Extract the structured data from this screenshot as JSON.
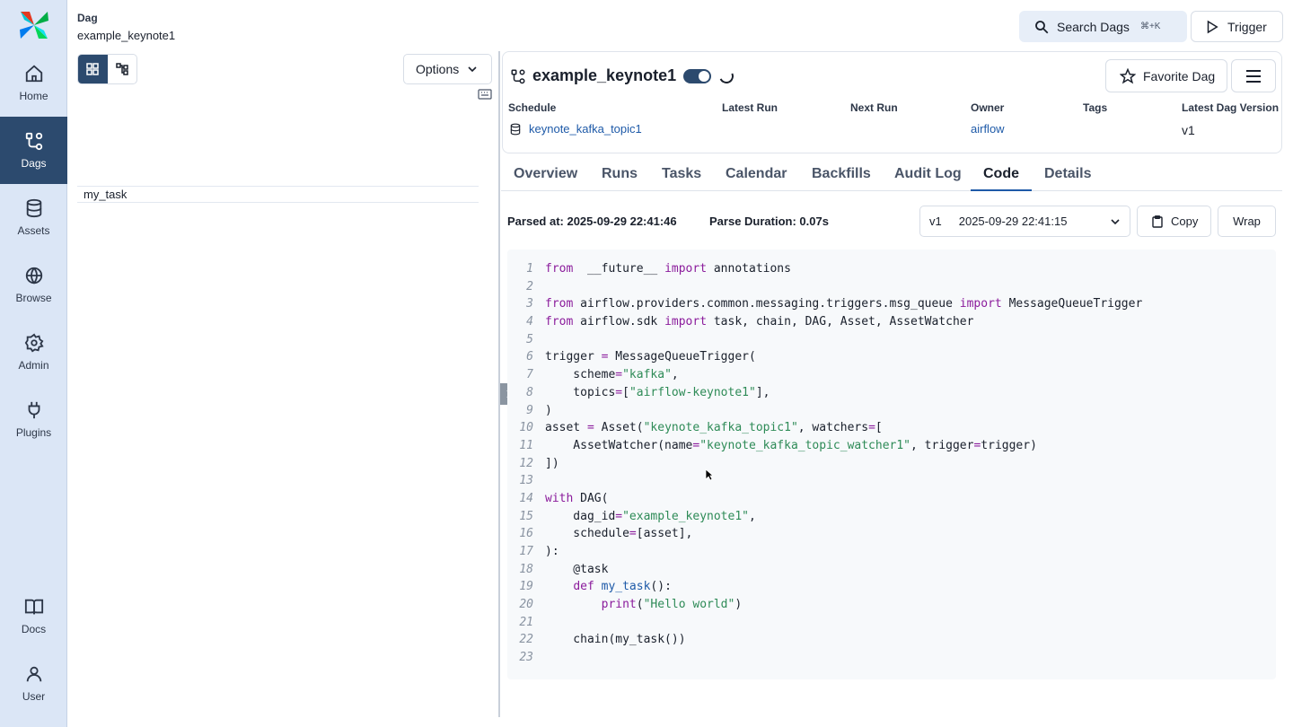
{
  "colors": {
    "sidebar_bg": "#dbe6f6",
    "active_nav": "#2c4a6e",
    "link": "#1e5aa8",
    "keyword": "#8b1c9c",
    "string": "#2e8b57"
  },
  "sidebar": {
    "items": [
      {
        "label": "Home",
        "icon": "home-icon"
      },
      {
        "label": "Dags",
        "icon": "dags-icon"
      },
      {
        "label": "Assets",
        "icon": "database-icon"
      },
      {
        "label": "Browse",
        "icon": "globe-icon"
      },
      {
        "label": "Admin",
        "icon": "gear-icon"
      },
      {
        "label": "Plugins",
        "icon": "plug-icon"
      },
      {
        "label": "Docs",
        "icon": "book-icon"
      },
      {
        "label": "User",
        "icon": "user-icon"
      }
    ]
  },
  "header": {
    "crumb_label": "Dag",
    "crumb_value": "example_keynote1",
    "search_label": "Search Dags",
    "search_shortcut": "⌘+K",
    "trigger_label": "Trigger"
  },
  "left_panel": {
    "options_label": "Options",
    "task_name": "my_task"
  },
  "dag": {
    "name": "example_keynote1",
    "favorite_label": "Favorite Dag",
    "meta_headers": {
      "schedule": "Schedule",
      "latest_run": "Latest Run",
      "next_run": "Next Run",
      "owner": "Owner",
      "tags": "Tags",
      "latest_version": "Latest Dag Version"
    },
    "schedule_value": "keynote_kafka_topic1",
    "owner_value": "airflow",
    "version_value": "v1"
  },
  "tabs": [
    "Overview",
    "Runs",
    "Tasks",
    "Calendar",
    "Backfills",
    "Audit Log",
    "Code",
    "Details"
  ],
  "code_view": {
    "parsed_at": "Parsed at: 2025-09-29 22:41:46",
    "parse_duration": "Parse Duration: 0.07s",
    "version": "v1",
    "version_date": "2025-09-29 22:41:15",
    "copy_label": "Copy",
    "wrap_label": "Wrap"
  },
  "code_lines": [
    [
      [
        "kw",
        "from"
      ],
      [
        "",
        "  __future__ "
      ],
      [
        "kw",
        "import"
      ],
      [
        "",
        " annotations"
      ]
    ],
    [],
    [
      [
        "kw",
        "from"
      ],
      [
        "",
        " airflow.providers.common.messaging.triggers.msg_queue "
      ],
      [
        "kw",
        "import"
      ],
      [
        "",
        " MessageQueueTrigger"
      ]
    ],
    [
      [
        "kw",
        "from"
      ],
      [
        "",
        " airflow.sdk "
      ],
      [
        "kw",
        "import"
      ],
      [
        "",
        " task, chain, DAG, Asset, AssetWatcher"
      ]
    ],
    [],
    [
      [
        "",
        "trigger "
      ],
      [
        "op",
        "="
      ],
      [
        "",
        " MessageQueueTrigger("
      ]
    ],
    [
      [
        "",
        "    scheme"
      ],
      [
        "op",
        "="
      ],
      [
        "str",
        "\"kafka\""
      ],
      [
        "",
        ","
      ]
    ],
    [
      [
        "",
        "    topics"
      ],
      [
        "op",
        "="
      ],
      [
        "",
        "["
      ],
      [
        "str",
        "\"airflow-keynote1\""
      ],
      [
        "",
        "],"
      ]
    ],
    [
      [
        "",
        ")"
      ]
    ],
    [
      [
        "",
        "asset "
      ],
      [
        "op",
        "="
      ],
      [
        "",
        " Asset("
      ],
      [
        "str",
        "\"keynote_kafka_topic1\""
      ],
      [
        "",
        ", watchers"
      ],
      [
        "op",
        "="
      ],
      [
        "",
        "["
      ]
    ],
    [
      [
        "",
        "    AssetWatcher(name"
      ],
      [
        "op",
        "="
      ],
      [
        "str",
        "\"keynote_kafka_topic_watcher1\""
      ],
      [
        "",
        ", trigger"
      ],
      [
        "op",
        "="
      ],
      [
        "",
        "trigger)"
      ]
    ],
    [
      [
        "",
        "])"
      ]
    ],
    [],
    [
      [
        "kw",
        "with"
      ],
      [
        "",
        " DAG("
      ]
    ],
    [
      [
        "",
        "    dag_id"
      ],
      [
        "op",
        "="
      ],
      [
        "str",
        "\"example_keynote1\""
      ],
      [
        "",
        ","
      ]
    ],
    [
      [
        "",
        "    schedule"
      ],
      [
        "op",
        "="
      ],
      [
        "",
        "[asset],"
      ]
    ],
    [
      [
        "",
        "):"
      ]
    ],
    [
      [
        "",
        "    @task"
      ]
    ],
    [
      [
        "",
        "    "
      ],
      [
        "kw",
        "def"
      ],
      [
        "",
        " "
      ],
      [
        "fn",
        "my_task"
      ],
      [
        "",
        "():"
      ]
    ],
    [
      [
        "",
        "        "
      ],
      [
        "kw",
        "print"
      ],
      [
        "",
        "("
      ],
      [
        "str",
        "\"Hello world\""
      ],
      [
        "",
        ")"
      ]
    ],
    [],
    [
      [
        "",
        "    chain(my_task())"
      ]
    ],
    []
  ]
}
